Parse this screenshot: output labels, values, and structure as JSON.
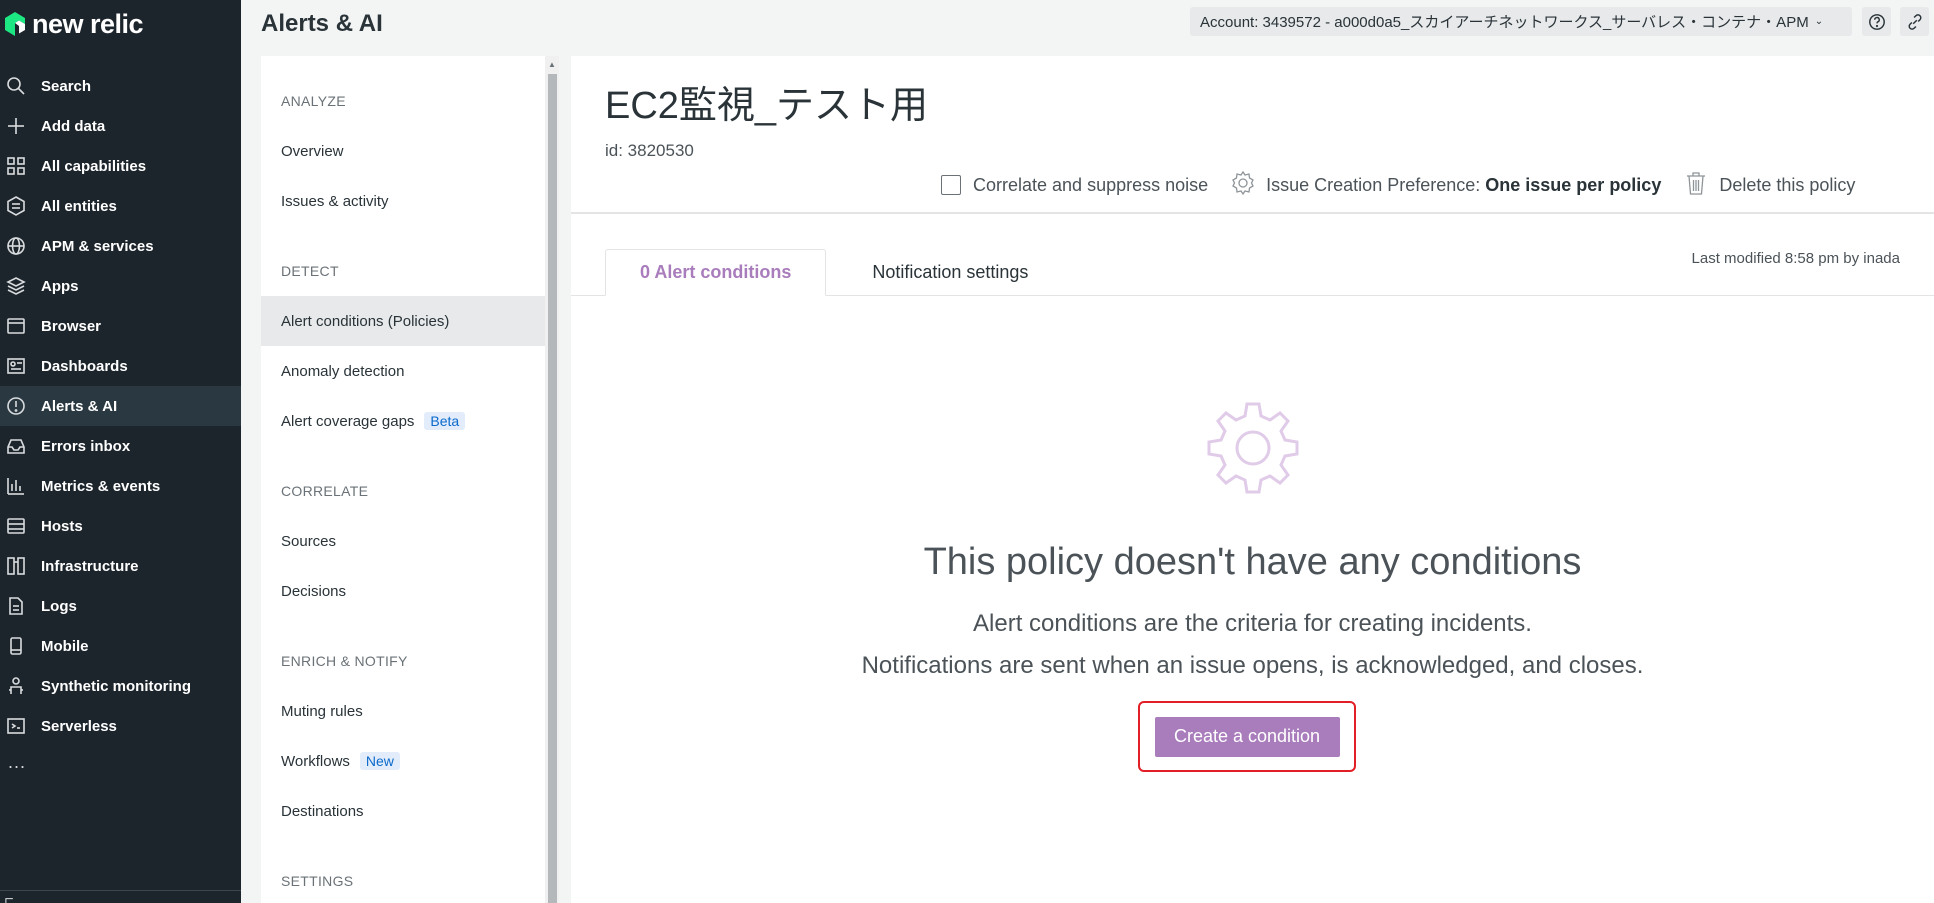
{
  "brand": {
    "logo_text": "new relic"
  },
  "nav": {
    "items": [
      {
        "label": "Search",
        "icon": "search-icon"
      },
      {
        "label": "Add data",
        "icon": "plus-icon"
      },
      {
        "label": "All capabilities",
        "icon": "grid-icon"
      },
      {
        "label": "All entities",
        "icon": "hexagon-icon"
      },
      {
        "label": "APM & services",
        "icon": "globe-icon"
      },
      {
        "label": "Apps",
        "icon": "layers-icon"
      },
      {
        "label": "Browser",
        "icon": "browser-icon"
      },
      {
        "label": "Dashboards",
        "icon": "dashboard-icon"
      },
      {
        "label": "Alerts & AI",
        "icon": "alert-icon",
        "active": true
      },
      {
        "label": "Errors inbox",
        "icon": "inbox-icon"
      },
      {
        "label": "Metrics & events",
        "icon": "bar-chart-icon"
      },
      {
        "label": "Hosts",
        "icon": "server-icon"
      },
      {
        "label": "Infrastructure",
        "icon": "infrastructure-icon"
      },
      {
        "label": "Logs",
        "icon": "document-icon"
      },
      {
        "label": "Mobile",
        "icon": "mobile-icon"
      },
      {
        "label": "Synthetic monitoring",
        "icon": "robot-icon"
      },
      {
        "label": "Serverless",
        "icon": "serverless-icon"
      }
    ],
    "more": "..."
  },
  "header": {
    "title": "Alerts & AI",
    "account": "Account: 3439572 - a000d0a5_スカイアーチネットワークス_サーバレス・コンテナ・APM"
  },
  "subnav": {
    "sections": [
      {
        "title": "ANALYZE",
        "items": [
          {
            "label": "Overview"
          },
          {
            "label": "Issues & activity"
          }
        ]
      },
      {
        "title": "DETECT",
        "items": [
          {
            "label": "Alert conditions (Policies)",
            "active": true
          },
          {
            "label": "Anomaly detection"
          },
          {
            "label": "Alert coverage gaps",
            "badge": "Beta"
          }
        ]
      },
      {
        "title": "CORRELATE",
        "items": [
          {
            "label": "Sources"
          },
          {
            "label": "Decisions"
          }
        ]
      },
      {
        "title": "ENRICH & NOTIFY",
        "items": [
          {
            "label": "Muting rules"
          },
          {
            "label": "Workflows",
            "badge": "New"
          },
          {
            "label": "Destinations"
          }
        ]
      },
      {
        "title": "SETTINGS",
        "items": []
      }
    ]
  },
  "policy": {
    "name": "EC2監視_テスト用",
    "id_label": "id: 3820530",
    "correlate_label": "Correlate and suppress noise",
    "issue_pref_label": "Issue Creation Preference:",
    "issue_pref_value": "One issue per policy",
    "delete_label": "Delete this policy"
  },
  "tabs": [
    {
      "label": "0 Alert conditions",
      "active": true
    },
    {
      "label": "Notification settings",
      "active": false
    }
  ],
  "last_modified": "Last modified 8:58 pm by inada",
  "empty_state": {
    "title": "This policy doesn't have any conditions",
    "line1": "Alert conditions are the criteria for creating incidents.",
    "line2": "Notifications are sent when an issue opens, is acknowledged, and closes.",
    "button": "Create a condition"
  },
  "colors": {
    "nav_bg": "#1d252c",
    "accent_purple": "#a97cbc",
    "highlight_red": "#e21e26",
    "badge_bg": "#e2ecfb",
    "badge_text": "#0b6acb"
  }
}
